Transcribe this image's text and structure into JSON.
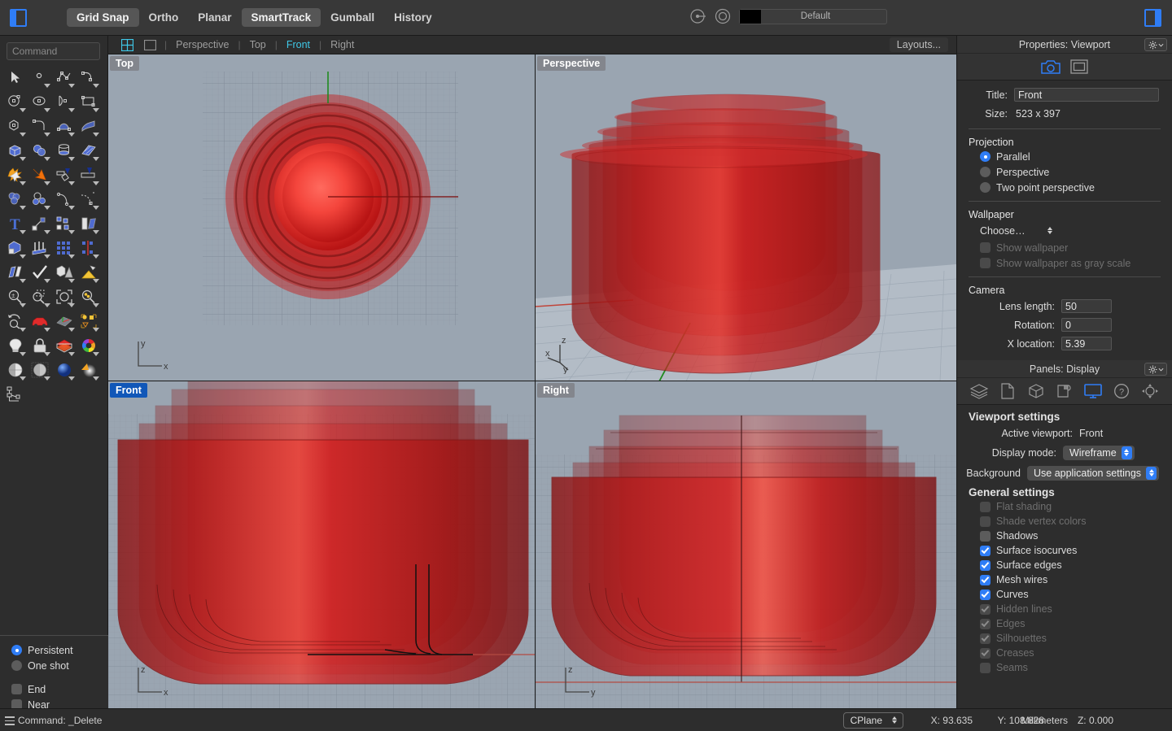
{
  "topbar": {
    "left_panel_toggle": "toggle-left-panel",
    "right_panel_toggle": "toggle-right-panel",
    "modes": [
      {
        "label": "Grid Snap",
        "active": true
      },
      {
        "label": "Ortho",
        "active": false
      },
      {
        "label": "Planar",
        "active": false
      },
      {
        "label": "SmartTrack",
        "active": true
      },
      {
        "label": "Gumball",
        "active": false
      },
      {
        "label": "History",
        "active": false
      }
    ],
    "material": {
      "swatch_color": "#000000",
      "label": "Default"
    }
  },
  "command": {
    "placeholder": "Command",
    "value": ""
  },
  "viewport_tabs": {
    "layout_icon": "four-view-icon",
    "single_icon": "single-view-icon",
    "tabs": [
      {
        "label": "Perspective",
        "active": false
      },
      {
        "label": "Top",
        "active": false
      },
      {
        "label": "Front",
        "active": true
      },
      {
        "label": "Right",
        "active": false
      }
    ],
    "layouts_button": "Layouts..."
  },
  "viewports": [
    {
      "label": "Top",
      "active": false,
      "axes": [
        "y",
        "x"
      ]
    },
    {
      "label": "Perspective",
      "active": false,
      "axes": [
        "z",
        "x",
        "y"
      ]
    },
    {
      "label": "Front",
      "active": true,
      "axes": [
        "z",
        "x"
      ]
    },
    {
      "label": "Right",
      "active": false,
      "axes": [
        "z",
        "y"
      ]
    }
  ],
  "osnap": {
    "mode_options": [
      {
        "label": "Persistent",
        "selected": true
      },
      {
        "label": "One shot",
        "selected": false
      }
    ],
    "snaps": [
      {
        "label": "End",
        "checked": false
      },
      {
        "label": "Near",
        "checked": false
      }
    ]
  },
  "properties_panel": {
    "title": "Properties: Viewport",
    "gear_button": "panel-options",
    "icons": [
      {
        "name": "camera-icon",
        "selected": true
      },
      {
        "name": "viewport-frame-icon",
        "selected": false
      }
    ],
    "title_label": "Title:",
    "title_value": "Front",
    "size_label": "Size:",
    "size_value": "523 x 397",
    "projection": {
      "heading": "Projection",
      "options": [
        {
          "label": "Parallel",
          "selected": true
        },
        {
          "label": "Perspective",
          "selected": false
        },
        {
          "label": "Two point perspective",
          "selected": false
        }
      ]
    },
    "wallpaper": {
      "heading": "Wallpaper",
      "choose_label": "Choose…",
      "checkboxes": [
        {
          "label": "Show wallpaper",
          "checked": false,
          "enabled": false
        },
        {
          "label": "Show wallpaper as gray scale",
          "checked": false,
          "enabled": false
        }
      ]
    },
    "camera": {
      "heading": "Camera",
      "fields": [
        {
          "label": "Lens length:",
          "value": "50"
        },
        {
          "label": "Rotation:",
          "value": "0"
        },
        {
          "label": "X location:",
          "value": "5.39"
        }
      ]
    }
  },
  "display_panel": {
    "title": "Panels: Display",
    "gear_button": "panel-options",
    "icons": [
      {
        "name": "layers-icon",
        "selected": false
      },
      {
        "name": "notes-icon",
        "selected": false
      },
      {
        "name": "properties-cube-icon",
        "selected": false
      },
      {
        "name": "render-icon",
        "selected": false
      },
      {
        "name": "display-monitor-icon",
        "selected": true
      },
      {
        "name": "help-icon",
        "selected": false
      },
      {
        "name": "named-views-icon",
        "selected": false
      }
    ],
    "viewport_settings": {
      "heading": "Viewport settings",
      "active_viewport_label": "Active viewport:",
      "active_viewport_value": "Front",
      "display_mode_label": "Display mode:",
      "display_mode_value": "Wireframe",
      "background_label": "Background",
      "background_value": "Use application settings"
    },
    "general_settings": {
      "heading": "General settings",
      "items": [
        {
          "label": "Flat shading",
          "checked": false,
          "enabled": false
        },
        {
          "label": "Shade vertex colors",
          "checked": false,
          "enabled": false
        },
        {
          "label": "Shadows",
          "checked": false,
          "enabled": true
        },
        {
          "label": "Surface isocurves",
          "checked": true,
          "enabled": true
        },
        {
          "label": "Surface edges",
          "checked": true,
          "enabled": true
        },
        {
          "label": "Mesh wires",
          "checked": true,
          "enabled": true
        },
        {
          "label": "Curves",
          "checked": true,
          "enabled": true
        },
        {
          "label": "Hidden lines",
          "checked": true,
          "enabled": false
        },
        {
          "label": "Edges",
          "checked": true,
          "enabled": false
        },
        {
          "label": "Silhouettes",
          "checked": true,
          "enabled": false
        },
        {
          "label": "Creases",
          "checked": true,
          "enabled": false
        },
        {
          "label": "Seams",
          "checked": false,
          "enabled": false
        }
      ]
    }
  },
  "statusbar": {
    "command_text": "Command: _Delete",
    "units": "Millimeters",
    "cplane": "CPlane",
    "x": "X: 93.635",
    "y": "Y: 108.828",
    "z": "Z: 0.000"
  },
  "colors": {
    "accent_blue": "#2f7df6",
    "tab_active": "#3fc8e8",
    "viewport_bg": "#9aa5b1",
    "object_red": "#c81414",
    "panel_bg": "#2d2d2d",
    "toolbar_bg": "#383838"
  }
}
